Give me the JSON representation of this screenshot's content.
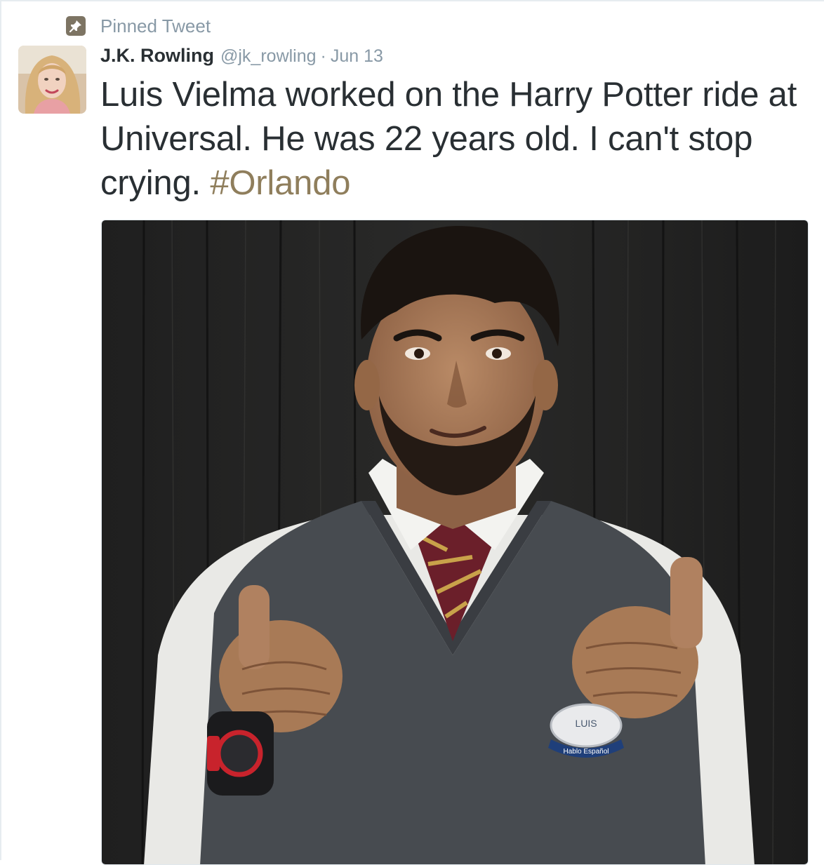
{
  "pinned": {
    "label": "Pinned Tweet",
    "icon": "pin-icon"
  },
  "author": {
    "name": "J.K. Rowling",
    "handle": "@jk_rowling",
    "separator": "·",
    "time": "Jun 13"
  },
  "tweet": {
    "text": "Luis Vielma worked on the Harry Potter ride at Universal. He was 22 years old. I can't stop crying. ",
    "hashtag": "#Orlando"
  },
  "media": {
    "badge_name": "LUIS",
    "badge_sub": "Hablo Español"
  },
  "colors": {
    "hashtag": "#8f7e5c",
    "pin_bg": "#7d7463",
    "meta": "#8899a6",
    "text": "#292f33"
  }
}
